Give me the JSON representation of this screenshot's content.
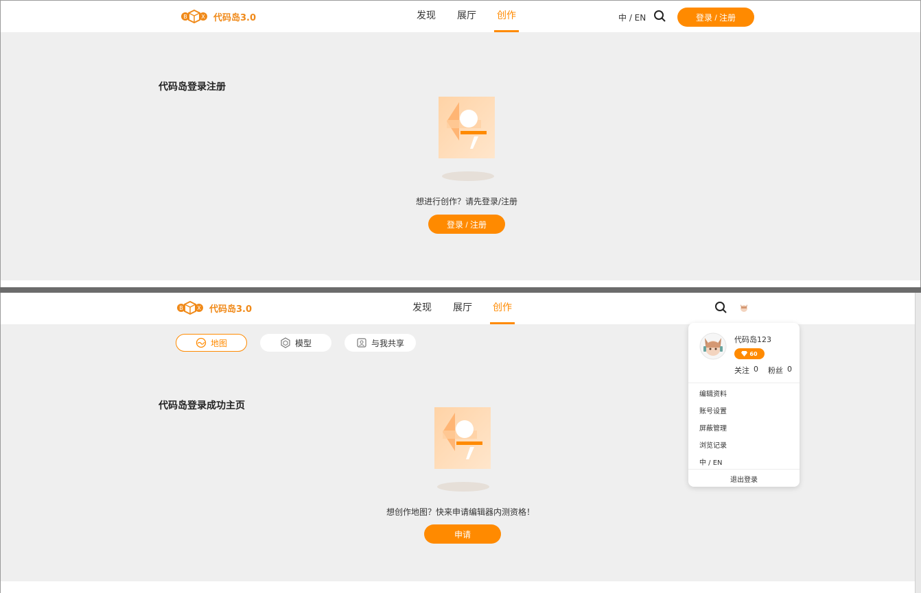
{
  "colors": {
    "accent": "#ff8a00",
    "background": "#efefef",
    "logo": "#f08a1a"
  },
  "top": {
    "logo_text": "代码岛3.0",
    "nav": {
      "discover": "发现",
      "hall": "展厅",
      "create": "创作"
    },
    "lang_switch": "中 / EN",
    "login_button": "登录 / 注册",
    "heading": "代码岛登录注册",
    "prompt": "想进行创作？请先登录/注册",
    "cta": "登录 / 注册"
  },
  "bottom": {
    "logo_text": "代码岛3.0",
    "nav": {
      "discover": "发现",
      "hall": "展厅",
      "create": "创作"
    },
    "tabs": [
      {
        "label": "地图",
        "icon": "map-icon",
        "active": true
      },
      {
        "label": "模型",
        "icon": "model-icon",
        "active": false
      },
      {
        "label": "与我共享",
        "icon": "shared-icon",
        "active": false
      }
    ],
    "heading": "代码岛登录成功主页",
    "prompt": "想创作地图？快来申请编辑器内测资格！",
    "cta": "申请",
    "user_menu": {
      "username": "代码岛123",
      "coins": "60",
      "following_label": "关注",
      "following_count": "0",
      "followers_label": "粉丝",
      "followers_count": "0",
      "items": [
        "编辑资料",
        "账号设置",
        "屏蔽管理",
        "浏览记录",
        "中 / EN"
      ],
      "logout": "退出登录"
    }
  }
}
